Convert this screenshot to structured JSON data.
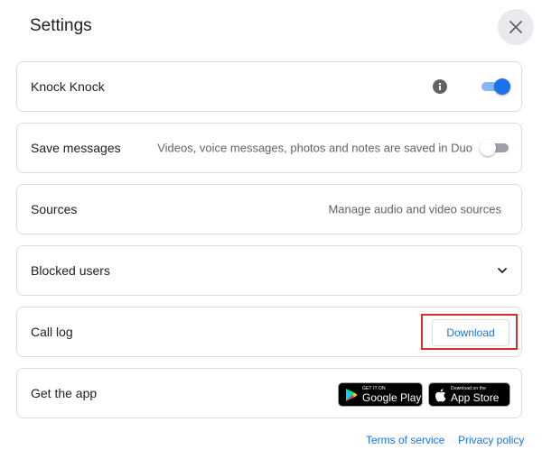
{
  "dialog": {
    "title": "Settings",
    "close_icon": "close-icon"
  },
  "settings": {
    "knock_knock": {
      "label": "Knock Knock",
      "info_icon": "info-icon",
      "enabled": true
    },
    "save_messages": {
      "label": "Save messages",
      "description": "Videos, voice messages, photos and notes are saved in Duo",
      "enabled": false
    },
    "sources": {
      "label": "Sources",
      "description": "Manage audio and video sources"
    },
    "blocked_users": {
      "label": "Blocked users",
      "expand_icon": "chevron-down-icon"
    },
    "call_log": {
      "label": "Call log",
      "download_label": "Download"
    },
    "get_the_app": {
      "label": "Get the app",
      "google_play": {
        "small_text": "GET IT ON",
        "big_text": "Google Play"
      },
      "app_store": {
        "small_text": "Download on the",
        "big_text": "App Store"
      }
    }
  },
  "footer": {
    "terms_label": "Terms of service",
    "privacy_label": "Privacy policy"
  },
  "colors": {
    "accent": "#1a73e8",
    "toggle_track_on": "#8ab4f8",
    "highlight": "#d93025",
    "border": "#dadce0",
    "secondary_text": "#5f6368"
  }
}
